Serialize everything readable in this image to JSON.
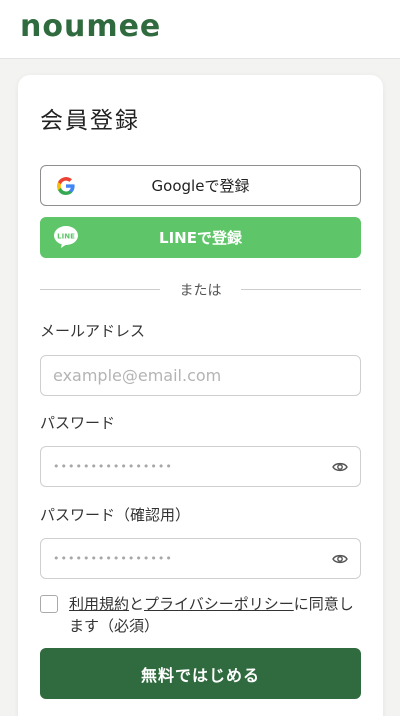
{
  "header": {
    "logo": "noumee"
  },
  "card": {
    "title": "会員登録",
    "google_button": "Googleで登録",
    "line_button": "LINEで登録",
    "divider": "または",
    "email": {
      "label": "メールアドレス",
      "placeholder": "example@email.com"
    },
    "password": {
      "label": "パスワード",
      "masked": "••••••••••••••••"
    },
    "password_confirm": {
      "label": "パスワード（確認用）",
      "masked": "••••••••••••••••"
    },
    "agree": {
      "terms_link": "利用規約",
      "and": "と",
      "privacy_link": "プライバシーポリシー",
      "suffix": "に同意します（必須）"
    },
    "submit": "無料ではじめる"
  },
  "colors": {
    "brand_green": "#2f6b3e",
    "line_green": "#5fc569"
  },
  "icons": [
    "google-icon",
    "line-icon",
    "eye-icon",
    "checkbox"
  ]
}
